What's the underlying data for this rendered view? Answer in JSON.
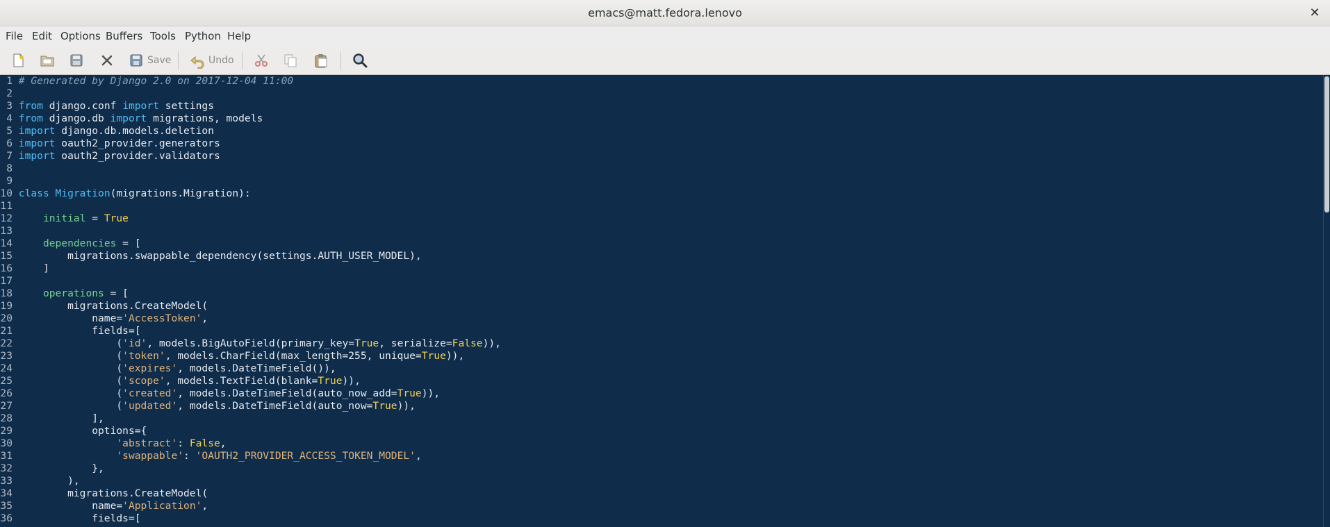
{
  "window": {
    "title": "emacs@matt.fedora.lenovo"
  },
  "menu": [
    "File",
    "Edit",
    "Options",
    "Buffers",
    "Tools",
    "Python",
    "Help"
  ],
  "toolbar": {
    "save_label": "Save",
    "undo_label": "Undo"
  },
  "colors": {
    "background": "#0f2d4b",
    "keyword": "#4fbcf6",
    "string": "#e0b27a",
    "constant": "#f2d04b",
    "variable": "#79d08f",
    "comment": "#8aa0b7"
  },
  "code_lines": [
    {
      "n": "1",
      "t": [
        [
          "cm",
          "# Generated by Django 2.0 on 2017-12-04 11:00"
        ]
      ]
    },
    {
      "n": "2",
      "t": []
    },
    {
      "n": "3",
      "t": [
        [
          "kw",
          "from"
        ],
        [
          "txt",
          " django.conf "
        ],
        [
          "kw",
          "import"
        ],
        [
          "txt",
          " settings"
        ]
      ]
    },
    {
      "n": "4",
      "t": [
        [
          "kw",
          "from"
        ],
        [
          "txt",
          " django.db "
        ],
        [
          "kw",
          "import"
        ],
        [
          "txt",
          " migrations, models"
        ]
      ]
    },
    {
      "n": "5",
      "t": [
        [
          "kw",
          "import"
        ],
        [
          "txt",
          " django.db.models.deletion"
        ]
      ]
    },
    {
      "n": "6",
      "t": [
        [
          "kw",
          "import"
        ],
        [
          "txt",
          " oauth2_provider.generators"
        ]
      ]
    },
    {
      "n": "7",
      "t": [
        [
          "kw",
          "import"
        ],
        [
          "txt",
          " oauth2_provider.validators"
        ]
      ]
    },
    {
      "n": "8",
      "t": []
    },
    {
      "n": "9",
      "t": []
    },
    {
      "n": "10",
      "t": [
        [
          "kw",
          "class"
        ],
        [
          "txt",
          " "
        ],
        [
          "fn",
          "Migration"
        ],
        [
          "txt",
          "(migrations.Migration):"
        ]
      ]
    },
    {
      "n": "11",
      "t": []
    },
    {
      "n": "12",
      "t": [
        [
          "txt",
          "    "
        ],
        [
          "var",
          "initial"
        ],
        [
          "txt",
          " = "
        ],
        [
          "const",
          "True"
        ]
      ]
    },
    {
      "n": "13",
      "t": []
    },
    {
      "n": "14",
      "t": [
        [
          "txt",
          "    "
        ],
        [
          "var",
          "dependencies"
        ],
        [
          "txt",
          " = ["
        ]
      ]
    },
    {
      "n": "15",
      "t": [
        [
          "txt",
          "        migrations.swappable_dependency(settings.AUTH_USER_MODEL),"
        ]
      ]
    },
    {
      "n": "16",
      "t": [
        [
          "txt",
          "    ]"
        ]
      ]
    },
    {
      "n": "17",
      "t": []
    },
    {
      "n": "18",
      "t": [
        [
          "txt",
          "    "
        ],
        [
          "var",
          "operations"
        ],
        [
          "txt",
          " = ["
        ]
      ]
    },
    {
      "n": "19",
      "t": [
        [
          "txt",
          "        migrations.CreateModel("
        ]
      ]
    },
    {
      "n": "20",
      "t": [
        [
          "txt",
          "            name="
        ],
        [
          "str",
          "'AccessToken'"
        ],
        [
          "txt",
          ","
        ]
      ]
    },
    {
      "n": "21",
      "t": [
        [
          "txt",
          "            fields=["
        ]
      ]
    },
    {
      "n": "22",
      "t": [
        [
          "txt",
          "                ("
        ],
        [
          "str",
          "'id'"
        ],
        [
          "txt",
          ", models.BigAutoField(primary_key="
        ],
        [
          "const",
          "True"
        ],
        [
          "txt",
          ", serialize="
        ],
        [
          "const",
          "False"
        ],
        [
          "txt",
          ")),"
        ]
      ]
    },
    {
      "n": "23",
      "t": [
        [
          "txt",
          "                ("
        ],
        [
          "str",
          "'token'"
        ],
        [
          "txt",
          ", models.CharField(max_length=255, unique="
        ],
        [
          "const",
          "True"
        ],
        [
          "txt",
          ")),"
        ]
      ]
    },
    {
      "n": "24",
      "t": [
        [
          "txt",
          "                ("
        ],
        [
          "str",
          "'expires'"
        ],
        [
          "txt",
          ", models.DateTimeField()),"
        ]
      ]
    },
    {
      "n": "25",
      "t": [
        [
          "txt",
          "                ("
        ],
        [
          "str",
          "'scope'"
        ],
        [
          "txt",
          ", models.TextField(blank="
        ],
        [
          "const",
          "True"
        ],
        [
          "txt",
          ")),"
        ]
      ]
    },
    {
      "n": "26",
      "t": [
        [
          "txt",
          "                ("
        ],
        [
          "str",
          "'created'"
        ],
        [
          "txt",
          ", models.DateTimeField(auto_now_add="
        ],
        [
          "const",
          "True"
        ],
        [
          "txt",
          ")),"
        ]
      ]
    },
    {
      "n": "27",
      "t": [
        [
          "txt",
          "                ("
        ],
        [
          "str",
          "'updated'"
        ],
        [
          "txt",
          ", models.DateTimeField(auto_now="
        ],
        [
          "const",
          "True"
        ],
        [
          "txt",
          ")),"
        ]
      ]
    },
    {
      "n": "28",
      "t": [
        [
          "txt",
          "            ],"
        ]
      ]
    },
    {
      "n": "29",
      "t": [
        [
          "txt",
          "            options={"
        ]
      ]
    },
    {
      "n": "30",
      "t": [
        [
          "txt",
          "                "
        ],
        [
          "str",
          "'abstract'"
        ],
        [
          "txt",
          ": "
        ],
        [
          "const",
          "False"
        ],
        [
          "txt",
          ","
        ]
      ]
    },
    {
      "n": "31",
      "t": [
        [
          "txt",
          "                "
        ],
        [
          "str",
          "'swappable'"
        ],
        [
          "txt",
          ": "
        ],
        [
          "str",
          "'OAUTH2_PROVIDER_ACCESS_TOKEN_MODEL'"
        ],
        [
          "txt",
          ","
        ]
      ]
    },
    {
      "n": "32",
      "t": [
        [
          "txt",
          "            },"
        ]
      ]
    },
    {
      "n": "33",
      "t": [
        [
          "txt",
          "        ),"
        ]
      ]
    },
    {
      "n": "34",
      "t": [
        [
          "txt",
          "        migrations.CreateModel("
        ]
      ]
    },
    {
      "n": "35",
      "t": [
        [
          "txt",
          "            name="
        ],
        [
          "str",
          "'Application'"
        ],
        [
          "txt",
          ","
        ]
      ]
    },
    {
      "n": "36",
      "t": [
        [
          "txt",
          "            fields=["
        ]
      ]
    }
  ]
}
